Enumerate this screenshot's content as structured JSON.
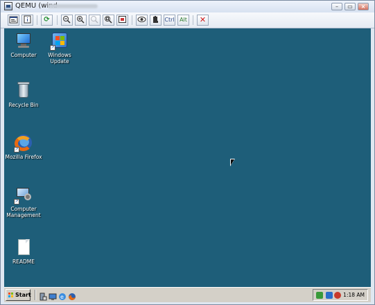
{
  "window": {
    "title": "QEMU (wind",
    "minimize_label": "–",
    "restore_label": "▭",
    "close_label": "×"
  },
  "toolbar": {
    "ctrl_label": "Ctrl",
    "alt_label": "Alt"
  },
  "desktop": {
    "background_color": "#1e5e79",
    "icons": [
      {
        "label": "Computer",
        "icon": "computer-icon"
      },
      {
        "label": "Windows Update",
        "icon": "windows-update-icon"
      },
      {
        "label": "Recycle Bin",
        "icon": "recycle-bin-icon"
      },
      {
        "label": "Mozilla Firefox",
        "icon": "firefox-icon"
      },
      {
        "label": "Computer Management",
        "icon": "computer-management-icon"
      },
      {
        "label": "README",
        "icon": "document-icon"
      }
    ]
  },
  "taskbar": {
    "start_label": "Start",
    "clock": "1:18 AM"
  }
}
